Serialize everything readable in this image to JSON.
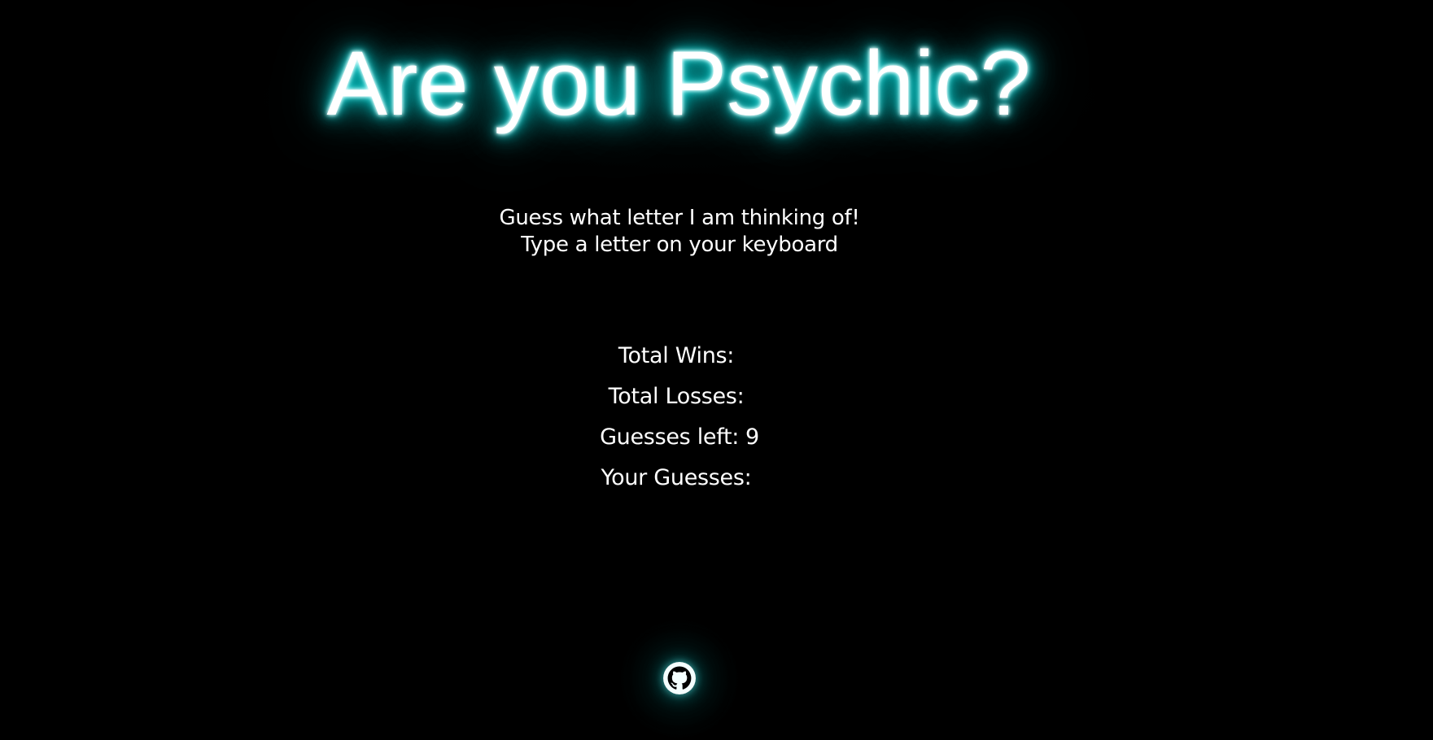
{
  "header": {
    "title": "Are you Psychic?"
  },
  "instructions": {
    "line1": "Guess what letter I am thinking of!",
    "line2": "Type a letter on your keyboard"
  },
  "stats": {
    "wins_label": "Total Wins:",
    "wins_value": "",
    "losses_label": "Total Losses:",
    "losses_value": "",
    "guesses_left_label": "Guesses left:",
    "guesses_left_value": "9",
    "your_guesses_label": "Your Guesses:",
    "your_guesses_value": ""
  },
  "footer": {
    "icon": "github-icon"
  },
  "colors": {
    "background": "#000000",
    "text": "#ffffff",
    "glow": "#00e5e5"
  }
}
